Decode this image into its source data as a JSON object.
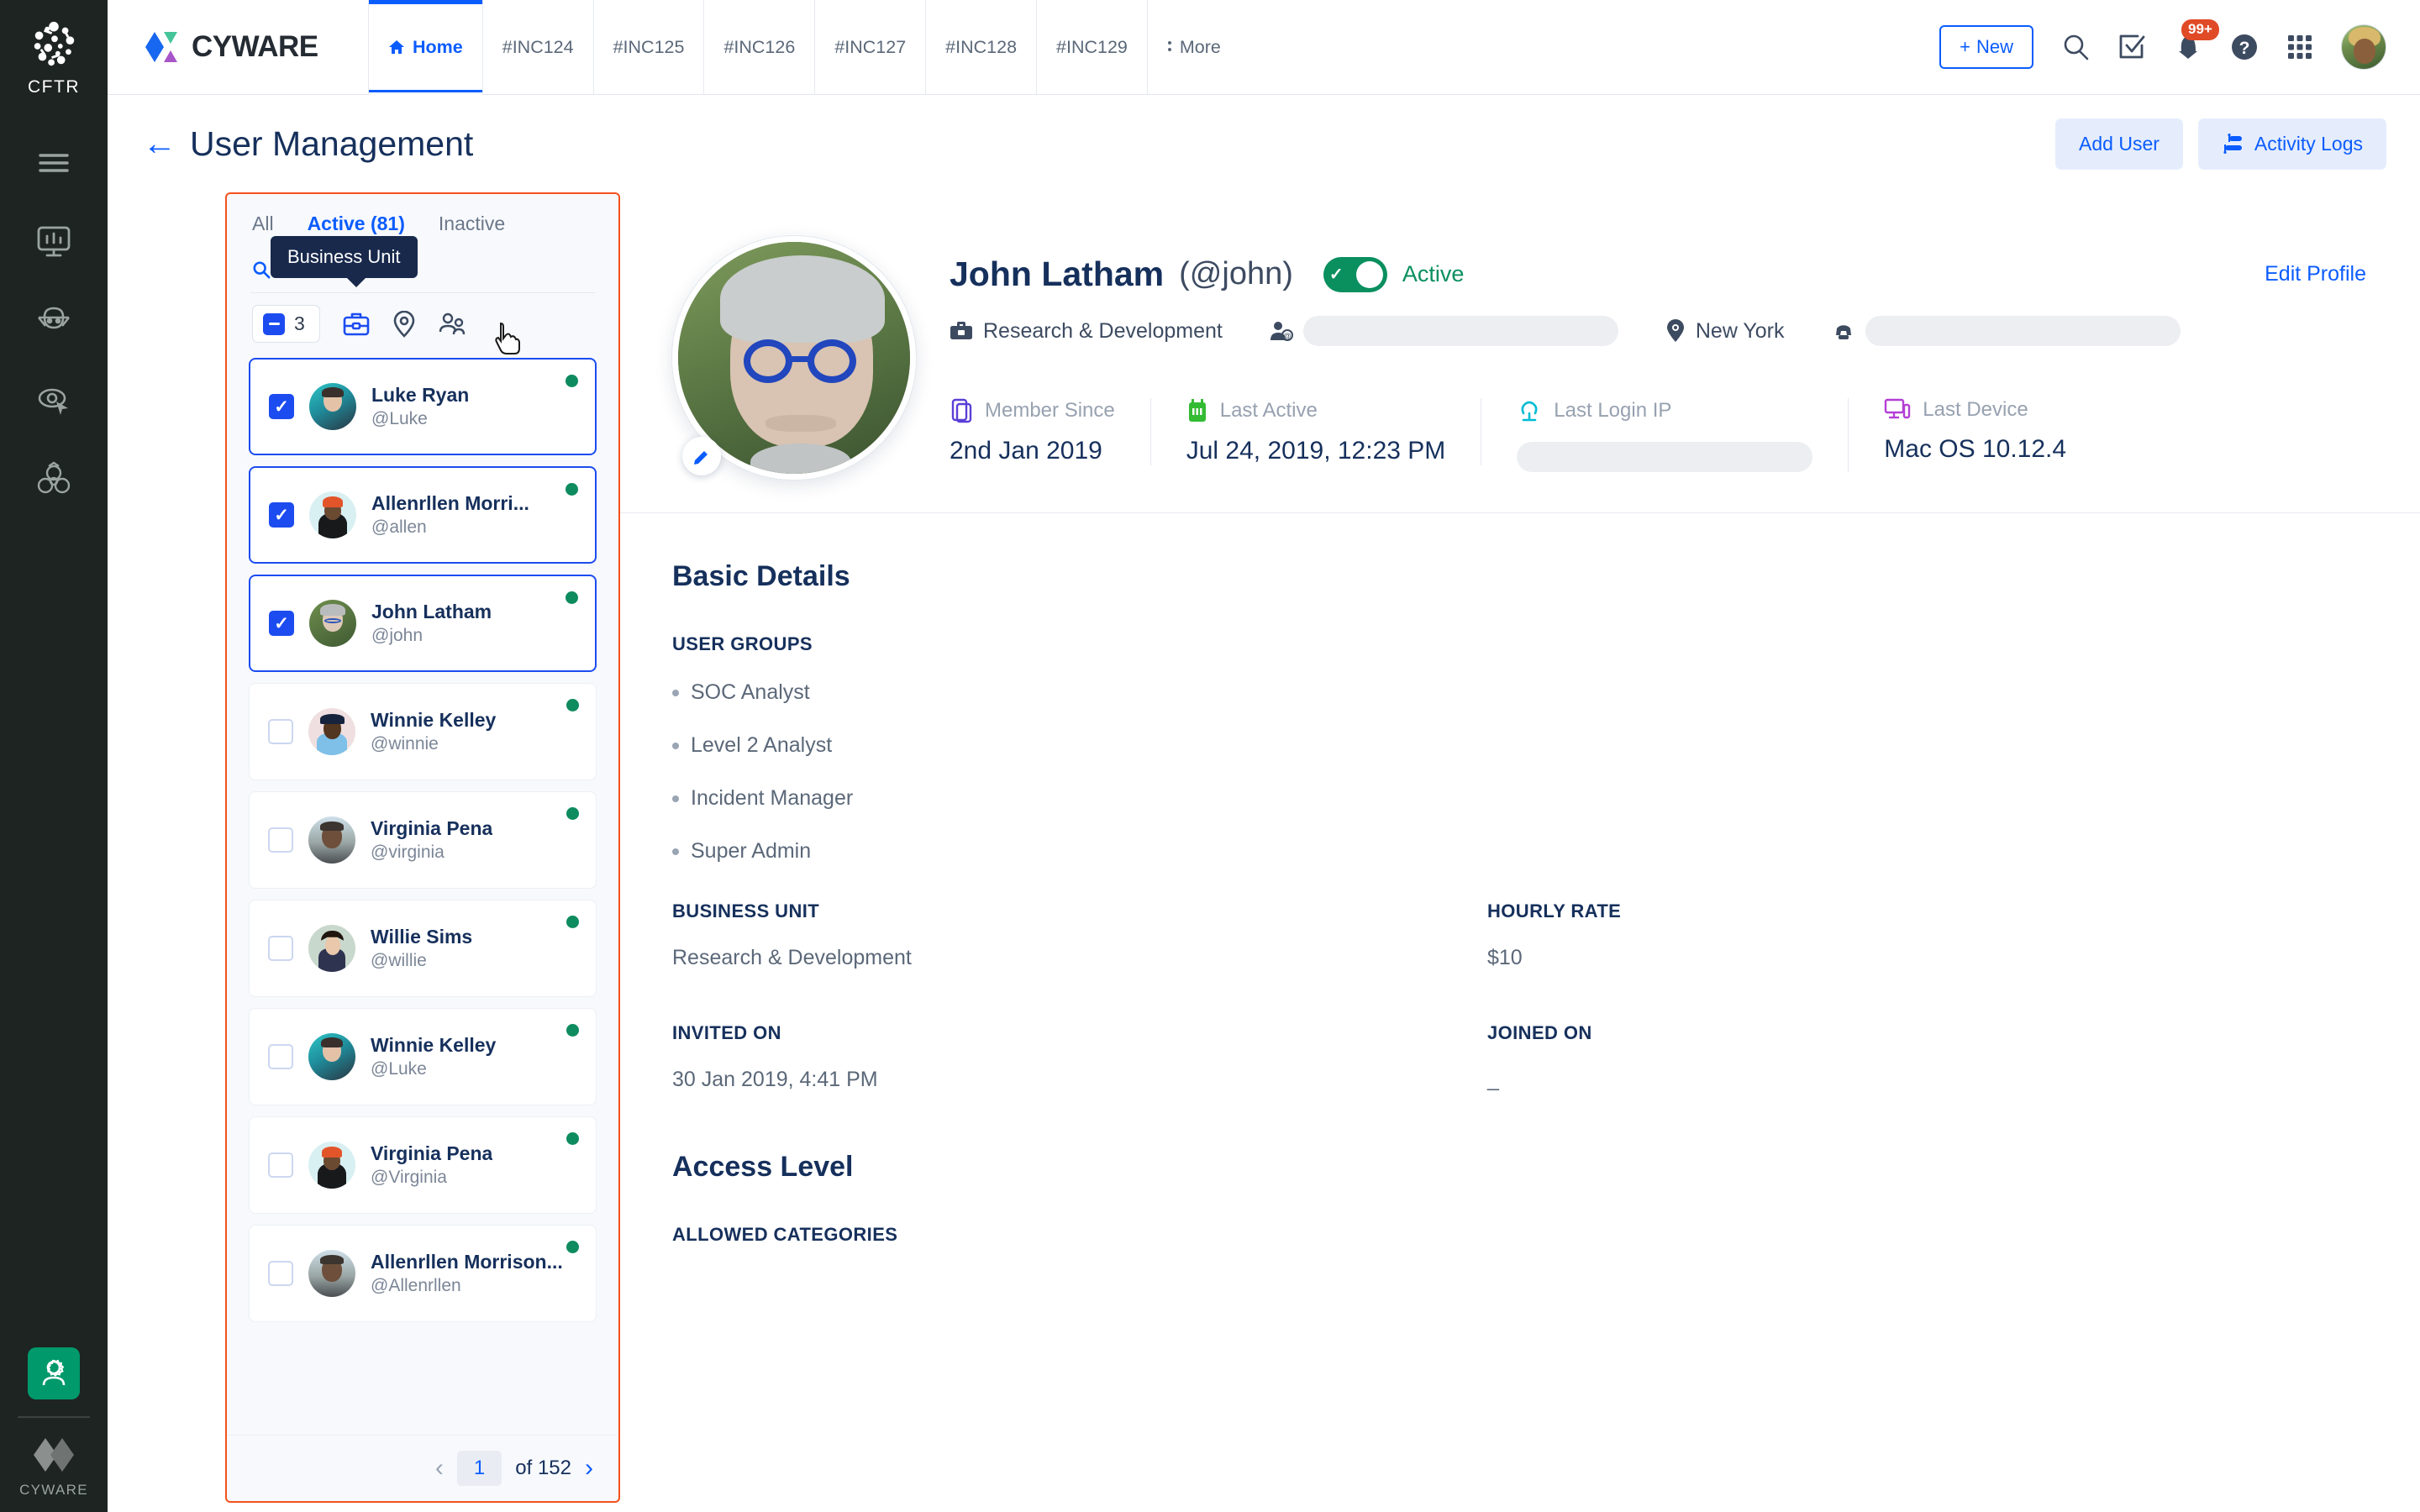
{
  "rail": {
    "logo_text": "CFTR",
    "icons": [
      {
        "name": "hamburger-menu-icon",
        "label": "Menu"
      },
      {
        "name": "dashboard-monitor-icon",
        "label": "Dashboard"
      },
      {
        "name": "threat-actor-icon",
        "label": "Threat Actor"
      },
      {
        "name": "threat-hunting-icon",
        "label": "Threat Hunting"
      },
      {
        "name": "malware-biohazard-icon",
        "label": "Malware"
      }
    ],
    "active_item": {
      "name": "user-management-icon",
      "label": "User Management"
    },
    "footer_text": "CYWARE"
  },
  "topnav": {
    "brand": "CYWARE",
    "tabs": [
      {
        "label": "Home",
        "active": true,
        "icon": "home-icon"
      },
      {
        "label": "#INC124",
        "active": false
      },
      {
        "label": "#INC125",
        "active": false
      },
      {
        "label": "#INC126",
        "active": false
      },
      {
        "label": "#INC127",
        "active": false
      },
      {
        "label": "#INC128",
        "active": false
      },
      {
        "label": "#INC129",
        "active": false
      },
      {
        "label": "More",
        "active": false,
        "icon": "more-vertical-icon"
      }
    ],
    "new_button": "New",
    "icons": [
      {
        "name": "search-icon"
      },
      {
        "name": "tasks-check-icon"
      },
      {
        "name": "notifications-bell-icon",
        "badge": "99+"
      },
      {
        "name": "help-question-icon"
      },
      {
        "name": "apps-grid-icon"
      }
    ],
    "notification_badge": "99+"
  },
  "pagehead": {
    "back_icon": "back-arrow-icon",
    "title": "User Management",
    "add_user": "Add User",
    "activity_logs": "Activity Logs"
  },
  "listpanel": {
    "tabs": [
      {
        "label": "All",
        "active": false
      },
      {
        "label": "Active (81)",
        "active": true
      },
      {
        "label": "Inactive",
        "active": false
      }
    ],
    "search_placeholder": "Search",
    "search_value": "",
    "selected_count": "3",
    "filters": [
      {
        "name": "business-unit-filter-icon",
        "label": "Business Unit",
        "active": true
      },
      {
        "name": "location-filter-icon",
        "label": "Location",
        "active": false
      },
      {
        "name": "user-group-filter-icon",
        "label": "User Group",
        "active": false
      }
    ],
    "tooltip": "Business Unit",
    "users": [
      {
        "name": "Luke Ryan",
        "handle": "@Luke",
        "checked": true,
        "selected": true,
        "status": "online"
      },
      {
        "name": "Allenrllen Morri...",
        "handle": "@allen",
        "checked": true,
        "selected": true,
        "status": "online"
      },
      {
        "name": "John Latham",
        "handle": "@john",
        "checked": true,
        "selected": true,
        "status": "online"
      },
      {
        "name": "Winnie Kelley",
        "handle": "@winnie",
        "checked": false,
        "selected": false,
        "status": "online"
      },
      {
        "name": "Virginia Pena",
        "handle": "@virginia",
        "checked": false,
        "selected": false,
        "status": "online"
      },
      {
        "name": "Willie Sims",
        "handle": "@willie",
        "checked": false,
        "selected": false,
        "status": "online"
      },
      {
        "name": "Winnie Kelley",
        "handle": "@Luke",
        "checked": false,
        "selected": false,
        "status": "online"
      },
      {
        "name": "Virginia Pena",
        "handle": "@Virginia",
        "checked": false,
        "selected": false,
        "status": "online"
      },
      {
        "name": "Allenrllen Morrison...",
        "handle": "@Allenrllen",
        "checked": false,
        "selected": false,
        "status": "online"
      }
    ],
    "pager": {
      "current": "1",
      "of_label": "of 152"
    }
  },
  "profile": {
    "name": "John Latham",
    "handle": "(@john)",
    "status_label": "Active",
    "status_on": true,
    "edit_profile": "Edit Profile",
    "business_unit": "Research & Development",
    "email_masked": "",
    "location": "New York",
    "phone_masked": "",
    "stats": [
      {
        "icon": "member-since-icon",
        "label": "Member Since",
        "value": "2nd Jan 2019",
        "masked": false
      },
      {
        "icon": "last-active-icon",
        "label": "Last Active",
        "value": "Jul 24, 2019, 12:23 PM",
        "masked": false
      },
      {
        "icon": "last-login-ip-icon",
        "label": "Last Login IP",
        "value": "",
        "masked": true
      },
      {
        "icon": "last-device-icon",
        "label": "Last Device",
        "value": "Mac OS 10.12.4",
        "masked": false
      }
    ]
  },
  "basic_details": {
    "title": "Basic Details",
    "user_groups_label": "USER GROUPS",
    "user_groups": [
      "SOC Analyst",
      "Level 2 Analyst",
      "Incident Manager",
      "Super Admin"
    ],
    "business_unit_label": "BUSINESS UNIT",
    "business_unit_value": "Research & Development",
    "hourly_rate_label": "HOURLY RATE",
    "hourly_rate_value": "$10",
    "invited_on_label": "INVITED ON",
    "invited_on_value": "30 Jan 2019, 4:41 PM",
    "joined_on_label": "JOINED ON",
    "joined_on_value": "_"
  },
  "access_level": {
    "title": "Access Level",
    "allowed_categories_label": "ALLOWED CATEGORIES"
  },
  "colors": {
    "accent_blue": "#0b5cff",
    "dark_navy": "#16305c",
    "active_green": "#0a8f5f",
    "highlight_orange": "#f4511e",
    "rail_dark": "#1d2422",
    "badge_red": "#e04a27"
  }
}
